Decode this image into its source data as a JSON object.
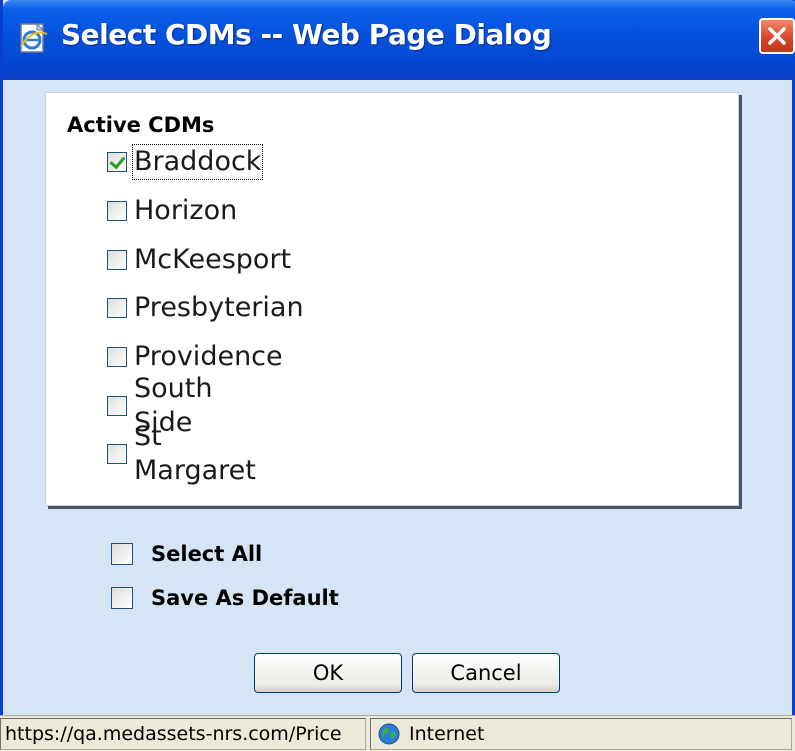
{
  "window": {
    "title": "Select CDMs -- Web Page Dialog",
    "title_icon": "ie-page-icon",
    "close_icon": "close-icon",
    "accent_color": "#0a5fe8",
    "close_color": "#d8452a"
  },
  "cdm_group": {
    "label": "Active CDMs",
    "items": [
      {
        "label": "Braddock",
        "checked": true
      },
      {
        "label": "Horizon",
        "checked": false
      },
      {
        "label": "McKeesport",
        "checked": false
      },
      {
        "label": "Presbyterian",
        "checked": false
      },
      {
        "label": "Providence",
        "checked": false
      },
      {
        "label": "South Side",
        "checked": false
      },
      {
        "label": "St Margaret",
        "checked": false
      }
    ]
  },
  "options": {
    "select_all_label": "Select All",
    "select_all_checked": false,
    "save_default_label": "Save As Default",
    "save_default_checked": false
  },
  "buttons": {
    "ok_label": "OK",
    "cancel_label": "Cancel"
  },
  "statusbar": {
    "url": "https://qa.medassets-nrs.com/Price",
    "zone_label": "Internet",
    "zone_icon": "globe-icon"
  }
}
